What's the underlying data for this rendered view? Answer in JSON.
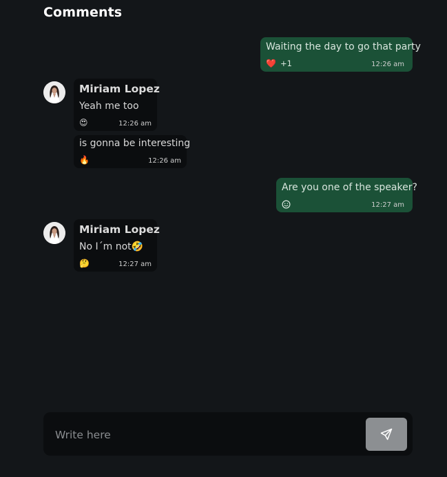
{
  "header": {
    "title": "Comments"
  },
  "messages": [
    {
      "from": "me",
      "text": "Waiting the day to go that party",
      "reaction": "❤️",
      "reaction_count": "+1",
      "time": "12:26 am"
    },
    {
      "from": "them",
      "sender": "Miriam Lopez",
      "text": "Yeah me too",
      "reaction": "😍",
      "time": "12:26 am"
    },
    {
      "from": "them",
      "text": "is gonna be interesting",
      "reaction": "🔥",
      "time": "12:26 am"
    },
    {
      "from": "me",
      "text": "Are you one of the speaker?",
      "reaction_icon": "add-reaction-icon",
      "time": "12:27 am"
    },
    {
      "from": "them",
      "sender": "Miriam Lopez",
      "text": "No I´m not🤣",
      "reaction": "🤔",
      "time": "12:27 am"
    }
  ],
  "composer": {
    "placeholder": "Write here",
    "value": "",
    "send_icon": "send-icon"
  },
  "colors": {
    "background": "#131619",
    "my_bubble": "#1b5137",
    "their_bubble": "#0b0d0f",
    "send_button": "#8c8f92"
  }
}
